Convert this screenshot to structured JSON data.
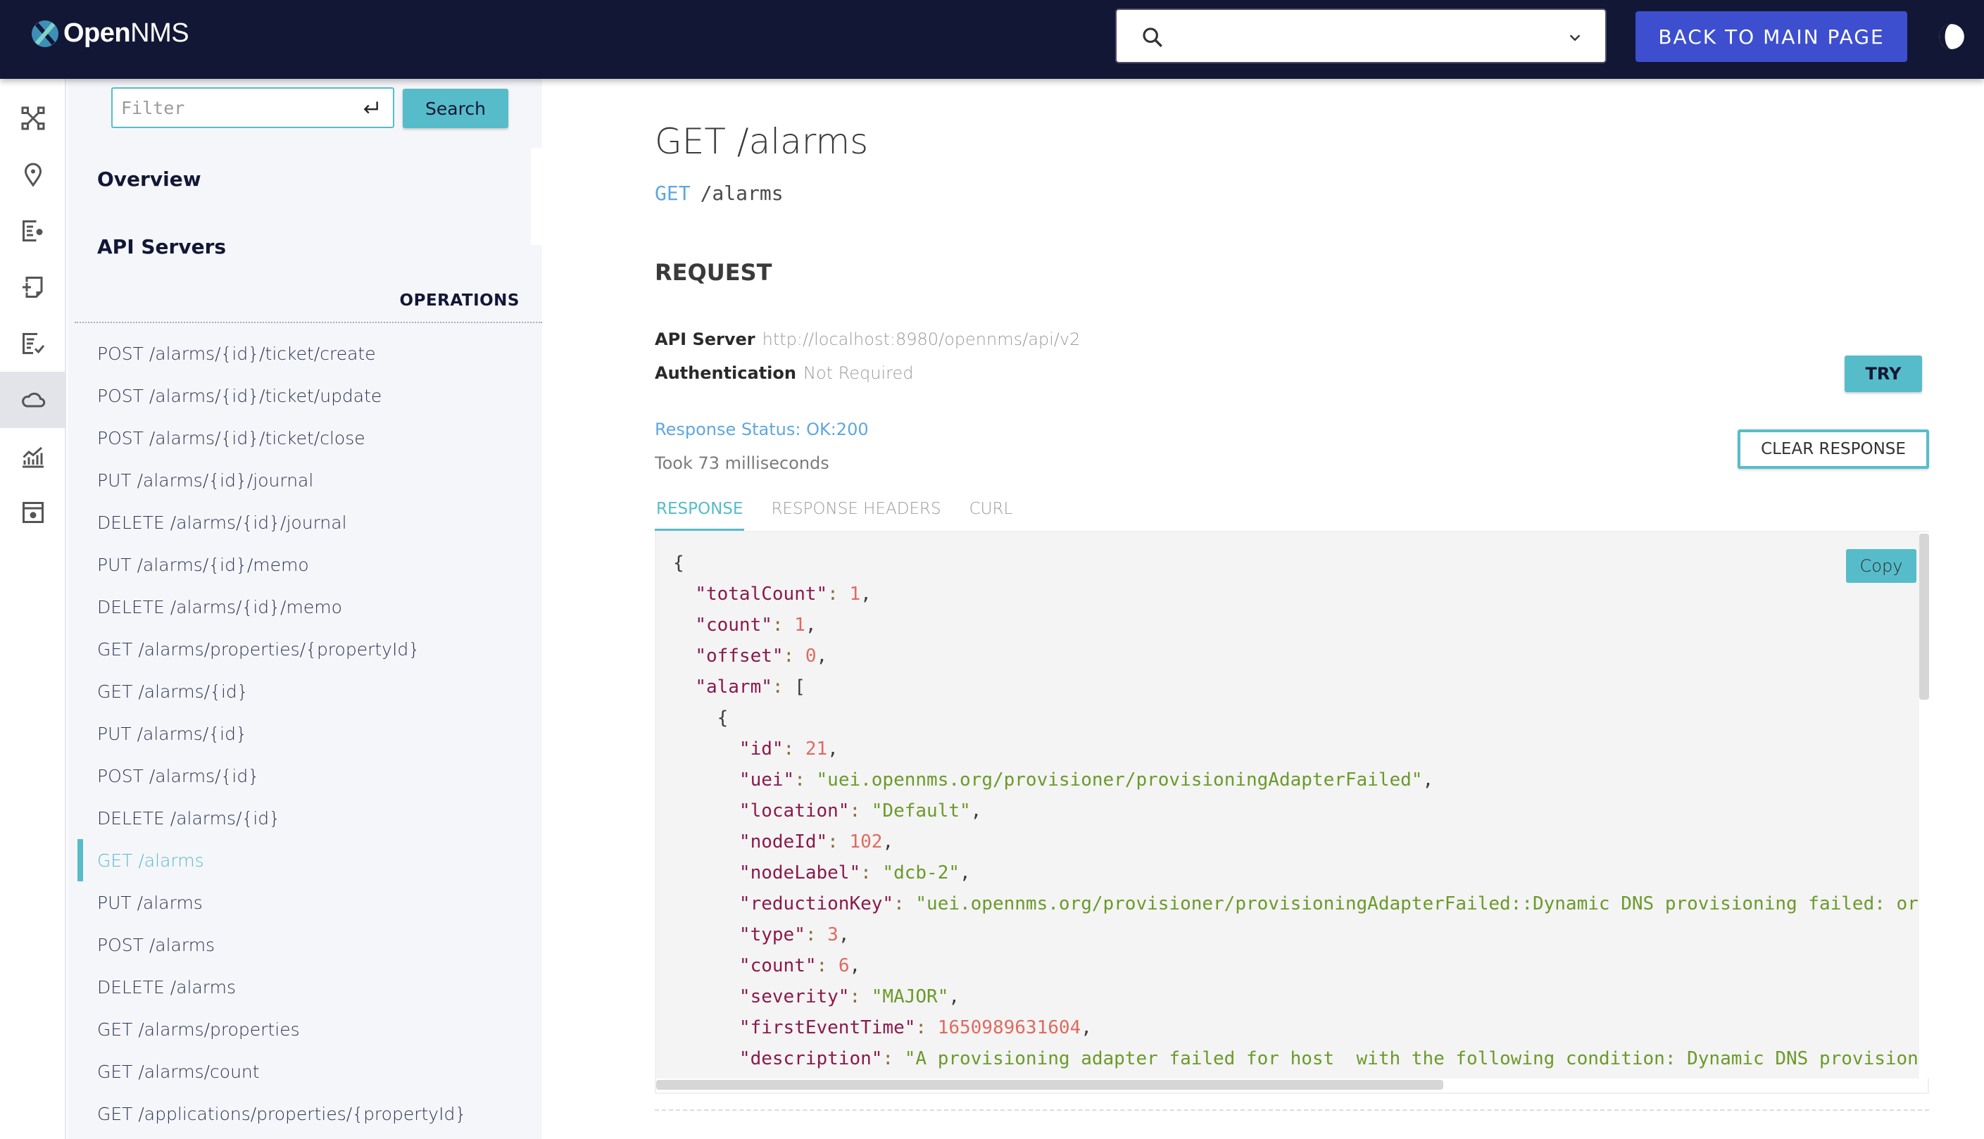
{
  "header": {
    "brand_bold": "Open",
    "brand_light": "NMS",
    "search_placeholder": "",
    "back_button": "BACK TO MAIN PAGE",
    "colors": {
      "bar": "#131736",
      "back_button": "#3d4fcf"
    }
  },
  "rail": {
    "items": [
      {
        "icon": "topology-icon",
        "active": false
      },
      {
        "icon": "location-pin-icon",
        "active": false
      },
      {
        "icon": "document-settings-icon",
        "active": false
      },
      {
        "icon": "add-note-icon",
        "active": false
      },
      {
        "icon": "document-check-icon",
        "active": false
      },
      {
        "icon": "cloud-icon",
        "active": true
      },
      {
        "icon": "chart-icon",
        "active": false
      },
      {
        "icon": "window-settings-icon",
        "active": false
      }
    ]
  },
  "sidebar": {
    "filter_placeholder": "Filter",
    "filter_value": "",
    "search_button": "Search",
    "overview": "Overview",
    "api_servers": "API Servers",
    "operations_label": "OPERATIONS",
    "operations": [
      {
        "label": "POST /alarms/{id}/ticket/create",
        "active": false
      },
      {
        "label": "POST /alarms/{id}/ticket/update",
        "active": false
      },
      {
        "label": "POST /alarms/{id}/ticket/close",
        "active": false
      },
      {
        "label": "PUT /alarms/{id}/journal",
        "active": false
      },
      {
        "label": "DELETE /alarms/{id}/journal",
        "active": false
      },
      {
        "label": "PUT /alarms/{id}/memo",
        "active": false
      },
      {
        "label": "DELETE /alarms/{id}/memo",
        "active": false
      },
      {
        "label": "GET /alarms/properties/{propertyId}",
        "active": false
      },
      {
        "label": "GET /alarms/{id}",
        "active": false
      },
      {
        "label": "PUT /alarms/{id}",
        "active": false
      },
      {
        "label": "POST /alarms/{id}",
        "active": false
      },
      {
        "label": "DELETE /alarms/{id}",
        "active": false
      },
      {
        "label": "GET /alarms",
        "active": true
      },
      {
        "label": "PUT /alarms",
        "active": false
      },
      {
        "label": "POST /alarms",
        "active": false
      },
      {
        "label": "DELETE /alarms",
        "active": false
      },
      {
        "label": "GET /alarms/properties",
        "active": false
      },
      {
        "label": "GET /alarms/count",
        "active": false
      },
      {
        "label": "GET /applications/properties/{propertyId}",
        "active": false
      }
    ],
    "accent": "#57bcc9"
  },
  "main": {
    "title": "GET /alarms",
    "method": "GET",
    "path": "/alarms",
    "request_heading": "REQUEST",
    "api_server_label": "API Server",
    "api_server_value": "http://localhost:8980/opennms/api/v2",
    "auth_label": "Authentication",
    "auth_value": "Not Required",
    "try_button": "TRY",
    "response_status": "Response Status: OK:200",
    "took": "Took 73 milliseconds",
    "clear_button": "CLEAR RESPONSE",
    "tabs": [
      {
        "label": "RESPONSE",
        "active": true
      },
      {
        "label": "RESPONSE HEADERS",
        "active": false
      },
      {
        "label": "CURL",
        "active": false
      }
    ],
    "copy_button": "Copy",
    "response_lines": [
      {
        "indent": 0,
        "key": null,
        "value": "{",
        "type": "punct",
        "comma": false
      },
      {
        "indent": 1,
        "key": "totalCount",
        "value": "1",
        "type": "num",
        "comma": true
      },
      {
        "indent": 1,
        "key": "count",
        "value": "1",
        "type": "num",
        "comma": true
      },
      {
        "indent": 1,
        "key": "offset",
        "value": "0",
        "type": "num",
        "comma": true
      },
      {
        "indent": 1,
        "key": "alarm",
        "value": "[",
        "type": "punct",
        "comma": false
      },
      {
        "indent": 2,
        "key": null,
        "value": "{",
        "type": "punct",
        "comma": false
      },
      {
        "indent": 3,
        "key": "id",
        "value": "21",
        "type": "num",
        "comma": true
      },
      {
        "indent": 3,
        "key": "uei",
        "value": "\"uei.opennms.org/provisioner/provisioningAdapterFailed\"",
        "type": "str",
        "comma": true
      },
      {
        "indent": 3,
        "key": "location",
        "value": "\"Default\"",
        "type": "str",
        "comma": true
      },
      {
        "indent": 3,
        "key": "nodeId",
        "value": "102",
        "type": "num",
        "comma": true
      },
      {
        "indent": 3,
        "key": "nodeLabel",
        "value": "\"dcb-2\"",
        "type": "str",
        "comma": true
      },
      {
        "indent": 3,
        "key": "reductionKey",
        "value": "\"uei.opennms.org/provisioner/provisioningAdapterFailed::Dynamic DNS provisioning failed: org",
        "type": "str",
        "comma": false
      },
      {
        "indent": 3,
        "key": "type",
        "value": "3",
        "type": "num",
        "comma": true
      },
      {
        "indent": 3,
        "key": "count",
        "value": "6",
        "type": "num",
        "comma": true
      },
      {
        "indent": 3,
        "key": "severity",
        "value": "\"MAJOR\"",
        "type": "str",
        "comma": true
      },
      {
        "indent": 3,
        "key": "firstEventTime",
        "value": "1650989631604",
        "type": "num",
        "comma": true
      },
      {
        "indent": 3,
        "key": "description",
        "value": "\"A provisioning adapter failed for host  with the following condition: Dynamic DNS provisioning",
        "type": "str",
        "comma": false
      }
    ],
    "colors": {
      "method": "#5fa7e0",
      "key": "#8a1a4a",
      "number": "#e06a60",
      "string": "#6b9a2a"
    }
  }
}
